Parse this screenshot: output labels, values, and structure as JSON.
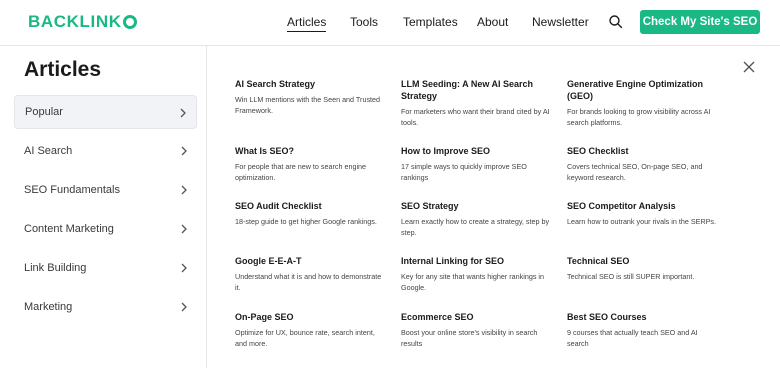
{
  "header": {
    "logo": "BACKLINK",
    "nav": [
      "Articles",
      "Tools",
      "Templates",
      "About",
      "Newsletter"
    ],
    "cta_label": "Check My Site's SEO",
    "brand_color": "#19b884"
  },
  "sidebar": {
    "title": "Articles",
    "items": [
      {
        "label": "Popular"
      },
      {
        "label": "AI Search"
      },
      {
        "label": "SEO Fundamentals"
      },
      {
        "label": "Content Marketing"
      },
      {
        "label": "Link Building"
      },
      {
        "label": "Marketing"
      }
    ]
  },
  "articles": [
    {
      "title": "AI Search Strategy",
      "desc": "Win LLM mentions with the Seen and Trusted Framework."
    },
    {
      "title": "LLM Seeding: A New AI Search Strategy",
      "desc": "For marketers who want their brand cited by AI tools."
    },
    {
      "title": "Generative Engine Optimization (GEO)",
      "desc": "For brands looking to grow visibility across AI search platforms."
    },
    {
      "title": "What Is SEO?",
      "desc": "For people that are new to search engine optimization."
    },
    {
      "title": "How to Improve SEO",
      "desc": "17 simple ways to quickly improve SEO rankings"
    },
    {
      "title": "SEO Checklist",
      "desc": "Covers technical SEO, On-page SEO, and keyword research."
    },
    {
      "title": "SEO Audit Checklist",
      "desc": "18-step guide to get higher Google rankings."
    },
    {
      "title": "SEO Strategy",
      "desc": "Learn exactly how to create a strategy, step by step."
    },
    {
      "title": "SEO Competitor Analysis",
      "desc": "Learn how to outrank your rivals in the SERPs."
    },
    {
      "title": "Google E-E-A-T",
      "desc": "Understand what it is and how to demonstrate it."
    },
    {
      "title": "Internal Linking for SEO",
      "desc": "Key for any site that wants higher rankings in Google."
    },
    {
      "title": "Technical SEO",
      "desc": "Technical SEO is still SUPER important."
    },
    {
      "title": "On-Page SEO",
      "desc": "Optimize for UX, bounce rate, search intent, and more."
    },
    {
      "title": "Ecommerce SEO",
      "desc": "Boost your online store's visibility in search results"
    },
    {
      "title": "Best SEO Courses",
      "desc": "9 courses that actually teach SEO and AI search"
    }
  ]
}
